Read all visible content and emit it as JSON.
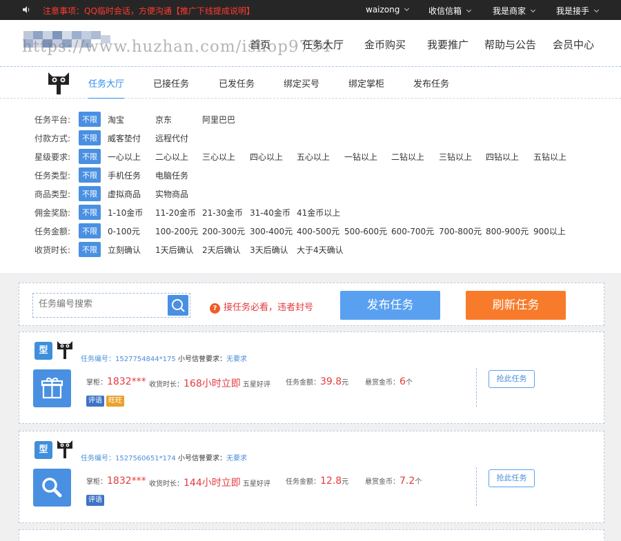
{
  "topbar": {
    "notice": "注意事项：QQ临时会话，方便沟通【推广下线提成说明】",
    "menus": [
      "waizong",
      "收信信箱",
      "我是商家",
      "我是接手"
    ]
  },
  "header": {
    "watermark": "https://www.huzhan.com/ishop9734",
    "nav": [
      "首页",
      "任务大厅",
      "金币购买",
      "我要推广",
      "帮助与公告",
      "会员中心"
    ]
  },
  "subnav": {
    "items": [
      "任务大厅",
      "已接任务",
      "已发任务",
      "绑定买号",
      "绑定掌柜",
      "发布任务"
    ],
    "active": 0
  },
  "filters": [
    {
      "label": "任务平台:",
      "options": [
        "不限",
        "淘宝",
        "京东",
        "阿里巴巴"
      ]
    },
    {
      "label": "付款方式:",
      "options": [
        "不限",
        "威客垫付",
        "远程代付"
      ]
    },
    {
      "label": "星级要求:",
      "options": [
        "不限",
        "一心以上",
        "二心以上",
        "三心以上",
        "四心以上",
        "五心以上",
        "一钻以上",
        "二钻以上",
        "三钻以上",
        "四钻以上",
        "五钻以上"
      ]
    },
    {
      "label": "任务类型:",
      "options": [
        "不限",
        "手机任务",
        "电脑任务"
      ]
    },
    {
      "label": "商品类型:",
      "options": [
        "不限",
        "虚拟商品",
        "实物商品"
      ]
    },
    {
      "label": "佣金奖励:",
      "options": [
        "不限",
        "1-10金币",
        "11-20金币",
        "21-30金币",
        "31-40金币",
        "41金币以上"
      ]
    },
    {
      "label": "任务金额:",
      "options": [
        "不限",
        "0-100元",
        "100-200元",
        "200-300元",
        "300-400元",
        "400-500元",
        "500-600元",
        "600-700元",
        "700-800元",
        "800-900元",
        "900以上"
      ]
    },
    {
      "label": "收货时长:",
      "options": [
        "不限",
        "立刻确认",
        "1天后确认",
        "2天后确认",
        "3天后确认",
        "大于4天确认"
      ]
    }
  ],
  "toolbar": {
    "search_placeholder": "任务编号搜索",
    "warning": "接任务必看，违者封号",
    "warning_icon": "?",
    "publish_label": "发布任务",
    "refresh_label": "刷新任务"
  },
  "tasks": [
    {
      "shop_icon_text": "型",
      "task_id_label": "任务编号：1527754844*175",
      "req_label": "小号信誉要求：",
      "req_value": "无要求",
      "shopkeeper_label": "掌柜：",
      "shopkeeper": "1832***",
      "receive_label": "收货时长：",
      "receive": "168小时立即",
      "rating": "五星好评",
      "amount_label": "任务金额：",
      "amount": "39.8",
      "amount_unit": "元",
      "reward_label": "悬赏金币：",
      "reward": "6",
      "reward_unit": "个",
      "tags": [
        "评语",
        "旺旺"
      ],
      "grab_label": "抢此任务",
      "icon": "gift-icon"
    },
    {
      "shop_icon_text": "型",
      "task_id_label": "任务编号：1527560651*174",
      "req_label": "小号信誉要求：",
      "req_value": "无要求",
      "shopkeeper_label": "掌柜：",
      "shopkeeper": "1832***",
      "receive_label": "收货时长：",
      "receive": "144小时立即",
      "rating": "五星好评",
      "amount_label": "任务金额：",
      "amount": "12.8",
      "amount_unit": "元",
      "reward_label": "悬赏金币：",
      "reward": "7.2",
      "reward_unit": "个",
      "tags": [
        "评语"
      ],
      "grab_label": "抢此任务",
      "icon": "search-icon"
    }
  ],
  "colors": {
    "accent": "#4a90e2",
    "orange": "#f77b2a",
    "red": "#e4393c"
  }
}
